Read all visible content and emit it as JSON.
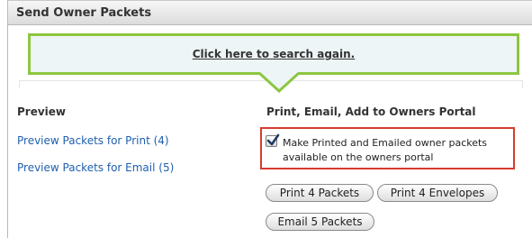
{
  "header": {
    "title": "Send Owner Packets"
  },
  "callout": {
    "search_again_link": "Click here to search again."
  },
  "preview": {
    "heading": "Preview",
    "print_link": "Preview Packets for Print (4)",
    "email_link": "Preview Packets for Email (5)"
  },
  "actions": {
    "heading": "Print, Email, Add to Owners Portal",
    "portal_checkbox": {
      "checked": true,
      "label": "Make Printed and Emailed owner packets available on the owners portal"
    },
    "buttons": {
      "print_packets": "Print 4 Packets",
      "print_envelopes": "Print 4 Envelopes",
      "email_packets": "Email 5 Packets"
    }
  },
  "colors": {
    "callout_border": "#8cc63f",
    "callout_bg": "#eef5f7",
    "highlight_border": "#d63b2f",
    "link": "#1f5fae"
  }
}
